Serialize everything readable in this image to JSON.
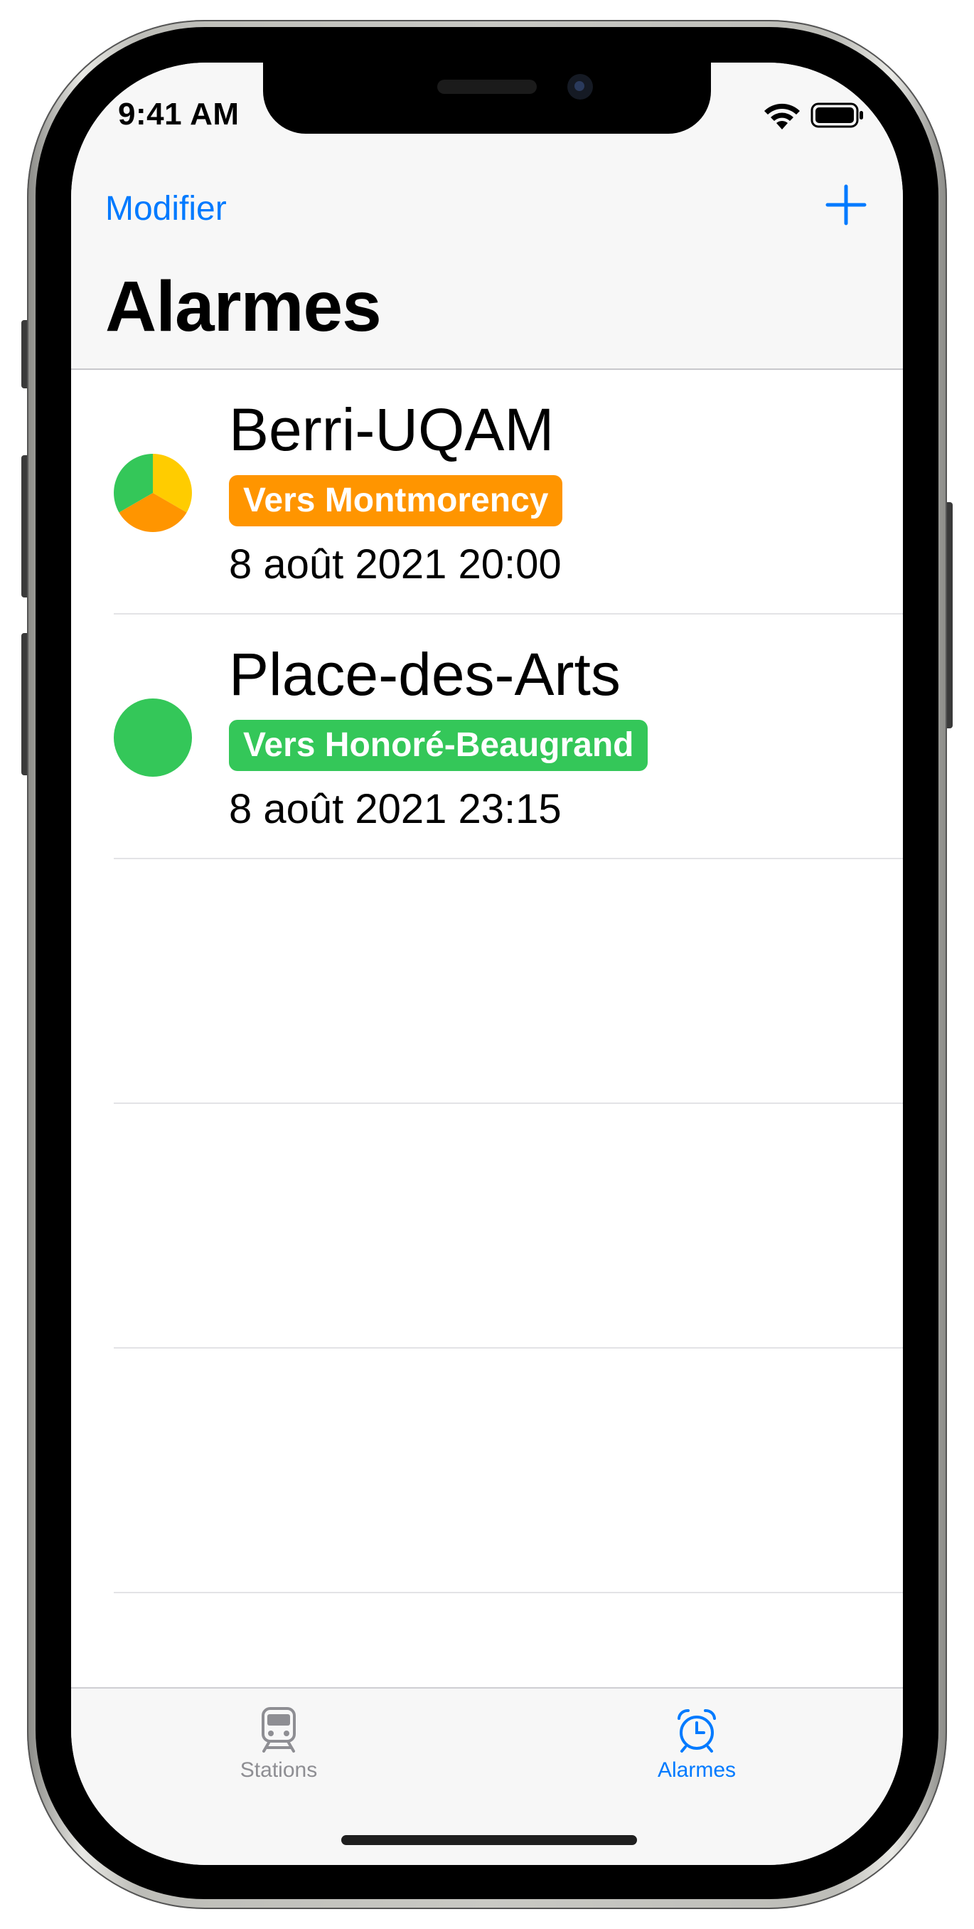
{
  "status_bar": {
    "time": "9:41 AM"
  },
  "nav": {
    "edit_label": "Modifier",
    "add_icon": "plus-icon",
    "title": "Alarmes"
  },
  "alarms": [
    {
      "station": "Berri-UQAM",
      "direction": "Vers Montmorency",
      "direction_color": "#ff9500",
      "datetime": "8 août 2021 20:00",
      "line_colors": [
        "#34c759",
        "#ffcc00",
        "#ff9500"
      ]
    },
    {
      "station": "Place-des-Arts",
      "direction": "Vers Honoré-Beaugrand",
      "direction_color": "#34c759",
      "datetime": "8 août 2021 23:15",
      "line_colors": [
        "#34c759"
      ]
    }
  ],
  "tabbar": {
    "tabs": [
      {
        "label": "Stations",
        "icon": "train-icon",
        "selected": false
      },
      {
        "label": "Alarmes",
        "icon": "alarm-clock-icon",
        "selected": true
      }
    ]
  },
  "colors": {
    "accent": "#007aff",
    "inactive_tab": "#8e8e93"
  }
}
